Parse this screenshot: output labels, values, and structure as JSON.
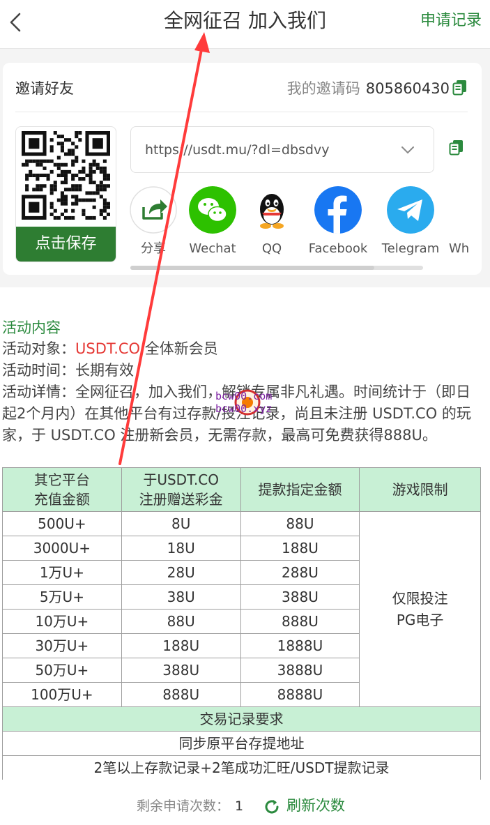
{
  "header": {
    "back": "<",
    "title": "全网征召 加入我们",
    "records_link": "申请记录"
  },
  "invite": {
    "title": "邀请好友",
    "code_label": "我的邀请码",
    "code_value": "805860430",
    "save_label": "点击保存",
    "url": "https://usdt.mu/?dl=dbsdvy"
  },
  "share": [
    {
      "label": "分享",
      "icon": "share-icon",
      "color": "#2e7d32"
    },
    {
      "label": "Wechat",
      "icon": "wechat-icon",
      "color": "#2dc100"
    },
    {
      "label": "QQ",
      "icon": "qq-icon",
      "color": "#111111"
    },
    {
      "label": "Facebook",
      "icon": "facebook-icon",
      "color": "#1877f2"
    },
    {
      "label": "Telegram",
      "icon": "telegram-icon",
      "color": "#2aabee"
    },
    {
      "label": "Wh",
      "icon": "whatsapp-icon",
      "color": "#25d366"
    }
  ],
  "activity": {
    "section_title": "活动内容",
    "target_label": "活动对象：",
    "target_brand": "USDT.CO",
    "target_rest": " 全体新会员",
    "time_label": "活动时间：",
    "time_value": "长期有效",
    "detail_label": "活动详情：",
    "detail_text": "全网征召，加入我们，解锁专属非凡礼遇。时间统计于（即日起2个月内）在其他平台有过存款/投注记录，尚且未注册 USDT.CO 的玩家，于 USDT.CO 注册新会员，无需存款，最高可免费获得888U。"
  },
  "table": {
    "headers": [
      "其它平台\n充值金额",
      "于USDT.CO\n注册赠送彩金",
      "提款指定金额",
      "游戏限制"
    ],
    "rows": [
      [
        "500U+",
        "8U",
        "88U"
      ],
      [
        "3000U+",
        "18U",
        "188U"
      ],
      [
        "1万U+",
        "28U",
        "288U"
      ],
      [
        "5万U+",
        "38U",
        "388U"
      ],
      [
        "10万U+",
        "88U",
        "888U"
      ],
      [
        "30万U+",
        "188U",
        "1888U"
      ],
      [
        "50万U+",
        "388U",
        "3888U"
      ],
      [
        "100万U+",
        "888U",
        "8888U"
      ]
    ],
    "game_limit": "仅限投注\nPG电子",
    "tx_title": "交易记录要求",
    "tx_req_1": "同步原平台存提地址",
    "tx_req_2": "2笔以上存款记录+2笔成功汇旺/USDT提款记录"
  },
  "footer": {
    "remain_label": "剩余申请次数：",
    "remain_value": "1",
    "refresh_label": "刷新次数"
  },
  "watermark": {
    "line1": "bcw00.com",
    "line2": "bcw00.xyz"
  },
  "colors": {
    "accent": "#2b8a3e",
    "save_button": "#2e7d32",
    "table_header": "#c8f0d5",
    "brand_red": "#e53935",
    "annotation_arrow": "#ff3b3b"
  }
}
